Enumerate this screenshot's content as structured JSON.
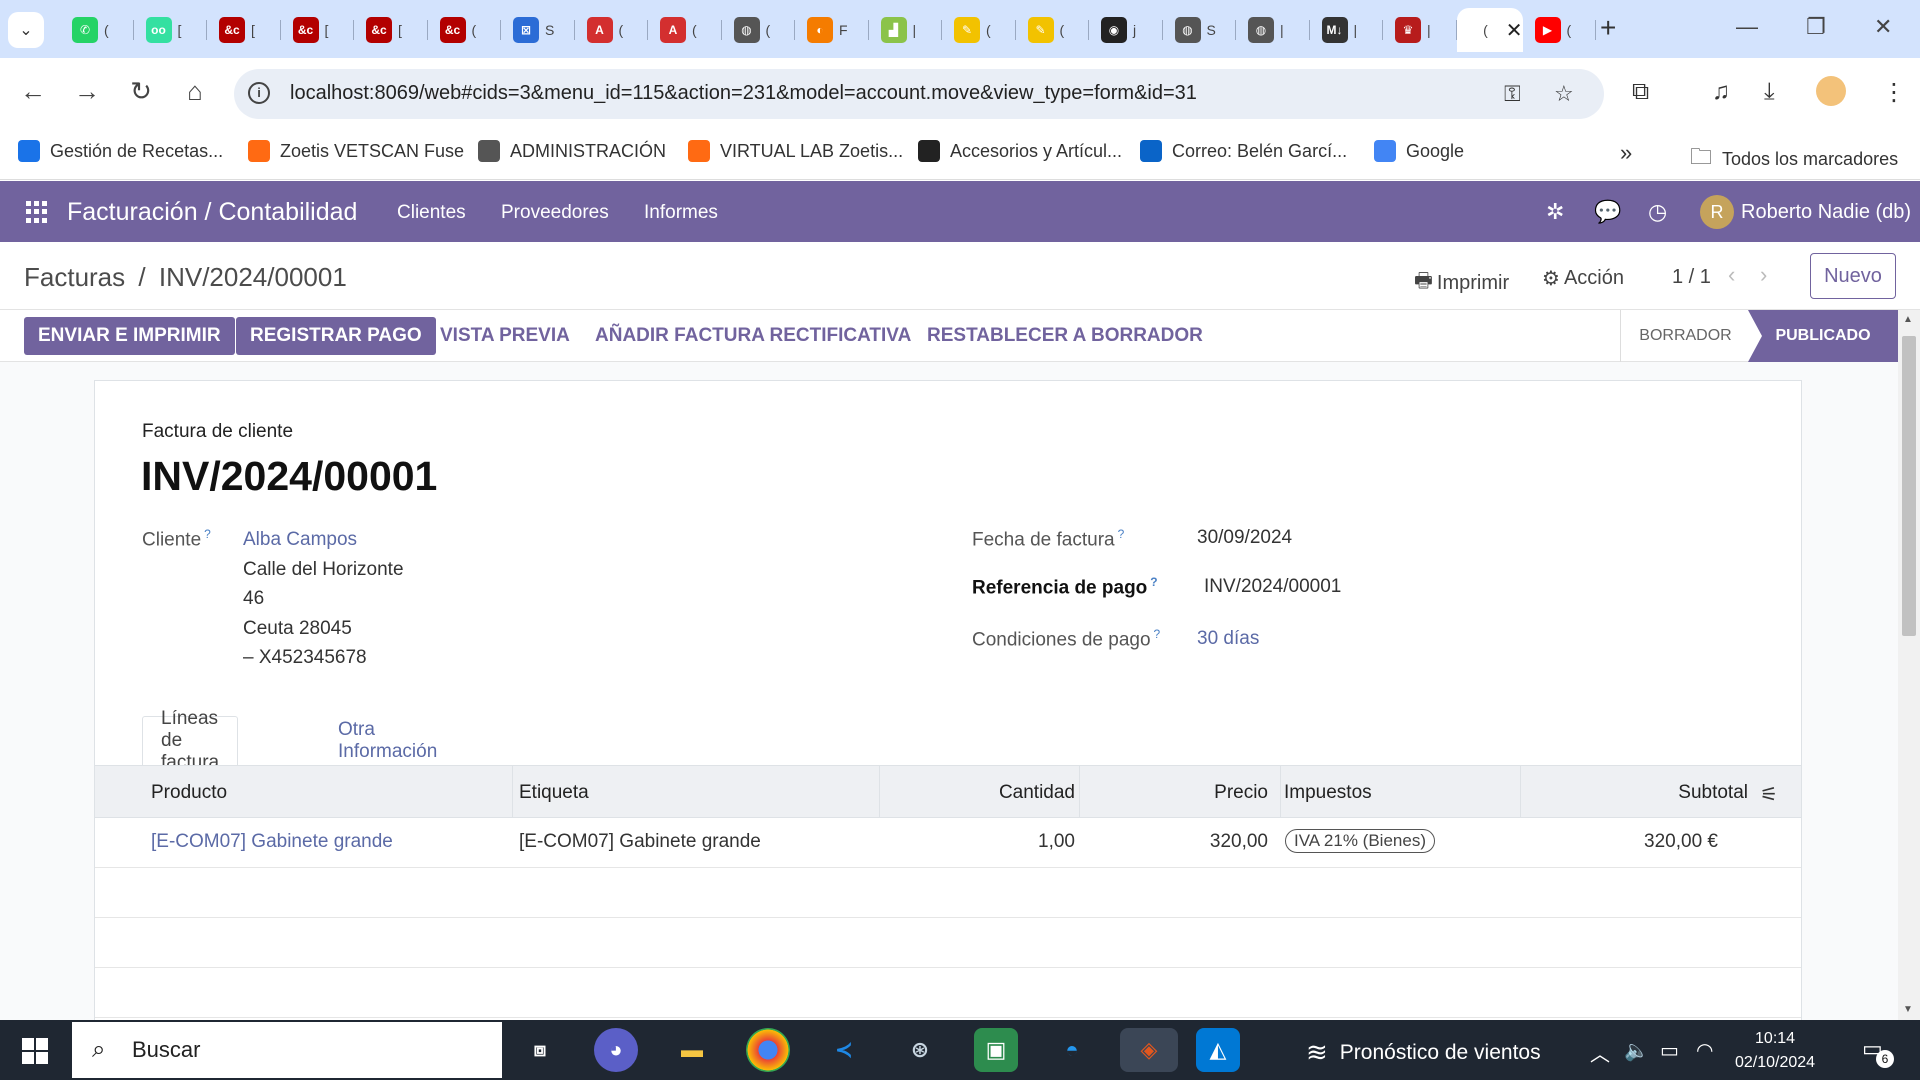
{
  "browser": {
    "tabs": [
      {
        "icon": "whatsapp-icon",
        "color": "#25d366",
        "glyph": "✆",
        "title": "("
      },
      {
        "icon": "tripadvisor-icon",
        "color": "#34e0a1",
        "glyph": "oo",
        "title": "["
      },
      {
        "icon": "bc-icon",
        "color": "#b30000",
        "glyph": "&c",
        "title": "["
      },
      {
        "icon": "bc-icon",
        "color": "#b30000",
        "glyph": "&c",
        "title": "["
      },
      {
        "icon": "bc-icon",
        "color": "#b30000",
        "glyph": "&c",
        "title": "["
      },
      {
        "icon": "bc-icon",
        "color": "#b30000",
        "glyph": "&c",
        "title": "("
      },
      {
        "icon": "grid-app-icon",
        "color": "#2b6cd6",
        "glyph": "⊠",
        "title": "S"
      },
      {
        "icon": "pdf-icon",
        "color": "#d32f2f",
        "glyph": "A",
        "title": "("
      },
      {
        "icon": "pdf-icon",
        "color": "#d32f2f",
        "glyph": "A",
        "title": "("
      },
      {
        "icon": "globe-icon",
        "color": "#555555",
        "glyph": "◍",
        "title": "("
      },
      {
        "icon": "orange-app-icon",
        "color": "#f57c00",
        "glyph": "◐",
        "title": "F"
      },
      {
        "icon": "chart-app-icon",
        "color": "#8bc34a",
        "glyph": "▟",
        "title": "|"
      },
      {
        "icon": "pen-app-icon",
        "color": "#f2c200",
        "glyph": "✎",
        "title": "("
      },
      {
        "icon": "pen-app-icon",
        "color": "#f2c200",
        "glyph": "✎",
        "title": "("
      },
      {
        "icon": "github-icon",
        "color": "#222222",
        "glyph": "◉",
        "title": "j"
      },
      {
        "icon": "globe-icon",
        "color": "#555555",
        "glyph": "◍",
        "title": "S"
      },
      {
        "icon": "globe-icon",
        "color": "#555555",
        "glyph": "◍",
        "title": "|"
      },
      {
        "icon": "markdown-icon",
        "color": "#333333",
        "glyph": "M↓",
        "title": "|"
      },
      {
        "icon": "coat-of-arms-icon",
        "color": "#b71c1c",
        "glyph": "♛",
        "title": "|"
      },
      {
        "icon": "odoo-tab-icon",
        "color": "#ffffff",
        "glyph": "",
        "title": "("
      },
      {
        "icon": "youtube-icon",
        "color": "#ff0000",
        "glyph": "▶",
        "title": "("
      }
    ],
    "url": "localhost:8069/web#cids=3&menu_id=115&action=231&model=account.move&view_type=form&id=31",
    "bookmarks": [
      {
        "icon": "recipes-icon",
        "color": "#1a73e8",
        "label": "Gestión de Recetas..."
      },
      {
        "icon": "zoetis-icon",
        "color": "#ff6a13",
        "label": "Zoetis VETSCAN Fuse"
      },
      {
        "icon": "globe-icon",
        "color": "#555555",
        "label": "ADMINISTRACIÓN"
      },
      {
        "icon": "zoetis-lab-icon",
        "color": "#ff6a13",
        "label": "VIRTUAL LAB Zoetis..."
      },
      {
        "icon": "accessories-icon",
        "color": "#222222",
        "label": "Accesorios y Artícul..."
      },
      {
        "icon": "outlook-icon",
        "color": "#0a64c8",
        "label": "Correo: Belén Garcí..."
      },
      {
        "icon": "google-icon",
        "color": "#4285f4",
        "label": "Google"
      }
    ],
    "more_bookmarks": "»",
    "all_bookmarks": "Todos los marcadores"
  },
  "odoo": {
    "brand": "Facturación / Contabilidad",
    "menu": [
      "Clientes",
      "Proveedores",
      "Informes"
    ],
    "user_initial": "R",
    "user_name": "Roberto Nadie (db)",
    "breadcrumb_parent": "Facturas",
    "breadcrumb_sep": "/",
    "breadcrumb_current": "INV/2024/00001",
    "print_label": "Imprimir",
    "action_label": "Acción",
    "pager": "1 / 1",
    "new_label": "Nuevo",
    "buttons": {
      "send_print": "ENVIAR E IMPRIMIR",
      "register_payment": "REGISTRAR PAGO",
      "preview": "VISTA PREVIA",
      "credit_note": "AÑADIR FACTURA RECTIFICATIVA",
      "reset_draft": "RESTABLECER A BORRADOR"
    },
    "status": {
      "draft": "BORRADOR",
      "posted": "PUBLICADO"
    },
    "colors": {
      "brand": "#71639e",
      "link": "#5b6aa6"
    }
  },
  "invoice": {
    "type": "Factura de cliente",
    "name": "INV/2024/00001",
    "customer_label": "Cliente",
    "customer_name": "Alba Campos",
    "address": [
      "Calle del Horizonte",
      "46",
      "Ceuta 28045",
      "– X452345678"
    ],
    "date_label": "Fecha de factura",
    "date_value": "30/09/2024",
    "payment_ref_label": "Referencia de pago",
    "payment_ref_value": "INV/2024/00001",
    "terms_label": "Condiciones de pago",
    "terms_value": "30 días",
    "help_mark": "?",
    "tabs": [
      "Líneas de factura",
      "Otra Información"
    ],
    "columns": {
      "product": "Producto",
      "label": "Etiqueta",
      "quantity": "Cantidad",
      "price": "Precio",
      "taxes": "Impuestos",
      "subtotal": "Subtotal"
    },
    "lines": [
      {
        "product": "[E-COM07] Gabinete grande",
        "label": "[E-COM07] Gabinete grande",
        "quantity": "1,00",
        "price": "320,00",
        "tax": "IVA 21% (Bienes)",
        "subtotal": "320,00 €"
      }
    ]
  },
  "taskbar": {
    "search_placeholder": "Buscar",
    "weather": "Pronóstico de vientos",
    "time": "10:14",
    "date": "02/10/2024",
    "notifications": "6"
  }
}
